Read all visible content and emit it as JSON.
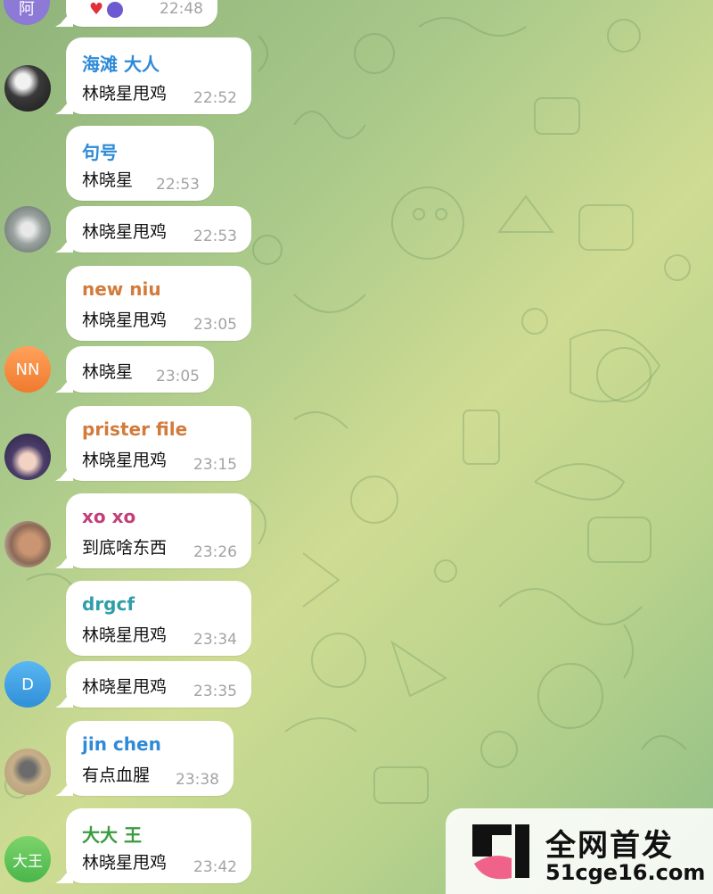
{
  "messages": [
    {
      "sender": "",
      "text": "",
      "time": "22:48"
    },
    {
      "sender": "海滩 大人",
      "text": "林晓星甩鸡",
      "time": "22:52"
    },
    {
      "sender": "句号",
      "text": "林晓星",
      "time": "22:53"
    },
    {
      "sender": "",
      "text": "林晓星甩鸡",
      "time": "22:53"
    },
    {
      "sender": "new niu",
      "text": "林晓星甩鸡",
      "time": "23:05"
    },
    {
      "sender": "",
      "text": "林晓星",
      "time": "23:05"
    },
    {
      "sender": "prister file",
      "text": "林晓星甩鸡",
      "time": "23:15"
    },
    {
      "sender": "xo xo",
      "text": "到底啥东西",
      "time": "23:26"
    },
    {
      "sender": "drgcf",
      "text": "林晓星甩鸡",
      "time": "23:34"
    },
    {
      "sender": "",
      "text": "林晓星甩鸡",
      "time": "23:35"
    },
    {
      "sender": "jin chen",
      "text": "有点血腥",
      "time": "23:38"
    },
    {
      "sender": "大大 王",
      "text": "林晓星甩鸡",
      "time": "23:42"
    }
  ],
  "avatars": {
    "top": "阿",
    "nn": "NN",
    "d": "D",
    "dawang": "大王"
  },
  "colors": {
    "sender_haitan": "#2f8ad8",
    "sender_juhao": "#2f8ad8",
    "sender_newniu": "#d27b3b",
    "sender_prister": "#d27b3b",
    "sender_xoxo": "#c2407a",
    "sender_drgcf": "#2f9ea8",
    "sender_jinchen": "#2f8ad8",
    "sender_dawang": "#3a9b3f"
  },
  "watermark": {
    "title": "全网首发",
    "url": "51cge16.com"
  }
}
